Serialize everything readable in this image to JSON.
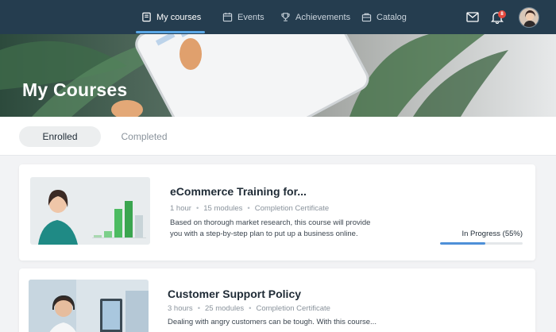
{
  "nav": {
    "items": [
      {
        "label": "My courses",
        "icon": "book-icon",
        "active": true
      },
      {
        "label": "Events",
        "icon": "calendar-icon",
        "active": false
      },
      {
        "label": "Achievements",
        "icon": "trophy-icon",
        "active": false
      },
      {
        "label": "Catalog",
        "icon": "catalog-icon",
        "active": false
      }
    ],
    "notifications_count": "8"
  },
  "hero": {
    "title": "My Courses"
  },
  "tabs": [
    {
      "label": "Enrolled",
      "active": true
    },
    {
      "label": "Completed",
      "active": false
    }
  ],
  "courses": [
    {
      "title": "eCommerce Training for...",
      "duration": "1 hour",
      "modules": "15 modules",
      "certificate": "Completion Certificate",
      "description": "Based on thorough market research, this course will provide you with a step-by-step plan to put up a business online.",
      "status": "In Progress (55%)",
      "progress": 0.55
    },
    {
      "title": "Customer Support Policy",
      "duration": "3 hours",
      "modules": "25 modules",
      "certificate": "Completion Certificate",
      "description": "Dealing with angry customers can be tough. With this course..."
    }
  ],
  "colors": {
    "topbar": "#253d4f",
    "accent": "#4e90d8",
    "badge": "#e5483d",
    "chart_green": "#3aa54f"
  }
}
